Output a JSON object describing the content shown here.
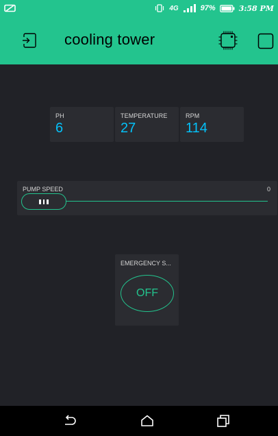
{
  "status_bar": {
    "network": "4G",
    "battery": "97%",
    "time": "3:58 PM"
  },
  "app_bar": {
    "title": "cooling tower",
    "icons": [
      "exit-icon",
      "device-chip-icon",
      "square-icon"
    ]
  },
  "widgets": {
    "ph": {
      "label": "PH",
      "value": "6"
    },
    "temperature": {
      "label": "TEMPERATURE",
      "value": "27"
    },
    "rpm": {
      "label": "RPM",
      "value": "114"
    },
    "pump_speed": {
      "label": "PUMP SPEED",
      "value": "0",
      "level": 0
    },
    "emergency": {
      "label": "EMERGENCY S...",
      "state": "OFF"
    }
  },
  "nav_bar": {
    "icons": [
      "back-icon",
      "home-icon",
      "recents-icon"
    ]
  },
  "colors": {
    "accent": "#23c48e",
    "value_blue": "#04c0f8",
    "canvas": "#212227",
    "widget": "#2b2c31"
  }
}
